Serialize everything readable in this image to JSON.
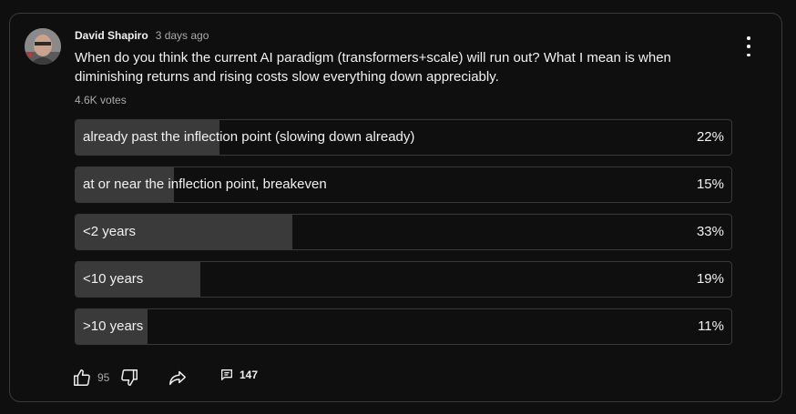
{
  "post": {
    "author": "David Shapiro",
    "time": "3 days ago",
    "question": "When do you think the current AI paradigm (transformers+scale) will run out? What I mean is when diminishing returns and rising costs slow everything down appreciably.",
    "votes": "4.6K votes"
  },
  "poll": {
    "options": [
      {
        "label": "already past the inflection point (slowing down already)",
        "percent": "22%",
        "share": 22
      },
      {
        "label": "at or near the inflection point, breakeven",
        "percent": "15%",
        "share": 15
      },
      {
        "label": "<2 years",
        "percent": "33%",
        "share": 33
      },
      {
        "label": "<10 years",
        "percent": "19%",
        "share": 19
      },
      {
        "label": ">10 years",
        "percent": "11%",
        "share": 11
      }
    ]
  },
  "actions": {
    "like_count": "95",
    "comment_count": "147",
    "icons": [
      "thumbs-up-icon",
      "thumbs-down-icon",
      "share-icon",
      "comment-icon",
      "more-vert-icon"
    ]
  },
  "colors": {
    "background": "#0f0f0f",
    "border": "#3a3a3a",
    "bar_fill": "#3a3a3a",
    "text": "#f1f1f1",
    "muted_text": "#aaaaaa"
  }
}
